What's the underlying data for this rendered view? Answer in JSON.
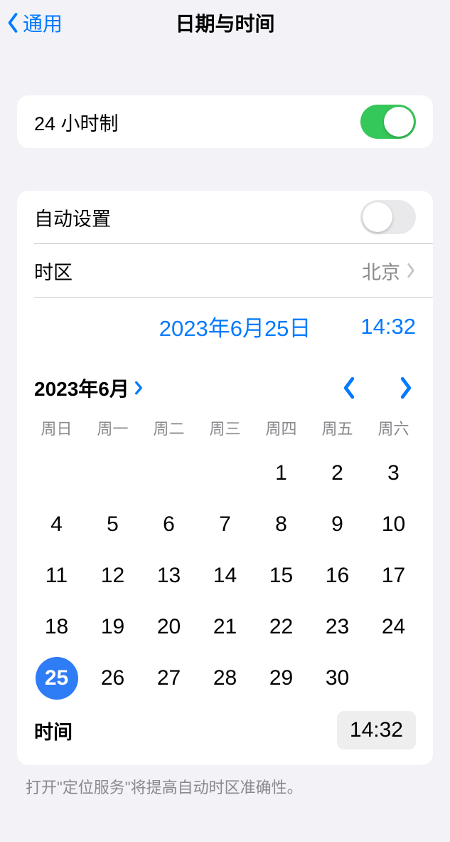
{
  "nav": {
    "back_label": "通用",
    "title": "日期与时间"
  },
  "hour24": {
    "label": "24 小时制",
    "on": true
  },
  "auto": {
    "label": "自动设置",
    "on": false
  },
  "timezone": {
    "label": "时区",
    "value": "北京"
  },
  "selected": {
    "date_label": "2023年6月25日",
    "time_label": "14:32"
  },
  "calendar": {
    "month_label": "2023年6月",
    "dow": [
      "周日",
      "周一",
      "周二",
      "周三",
      "周四",
      "周五",
      "周六"
    ],
    "leading_blanks": 4,
    "days_in_month": 30,
    "selected_day": 25
  },
  "time_row": {
    "label": "时间",
    "value": "14:32"
  },
  "footer_note": "打开\"定位服务\"将提高自动时区准确性。"
}
